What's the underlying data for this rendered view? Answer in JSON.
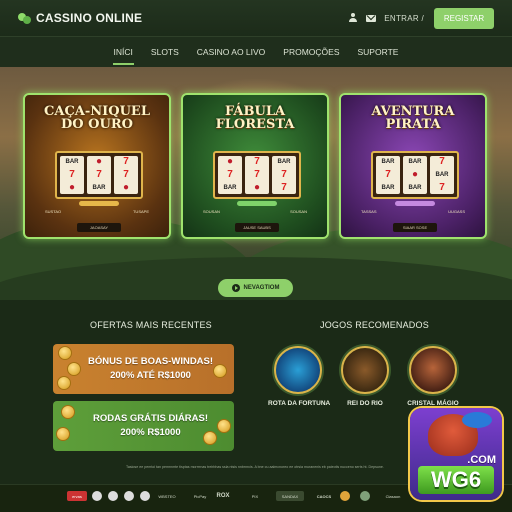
{
  "header": {
    "logo_text": "CASSINO ONLINE",
    "login_label": "ENTRAR /",
    "register_label": "REGISTAR"
  },
  "nav": {
    "items": [
      "INÍCI",
      "SLOTS",
      "CASINO AO LIVO",
      "PROMOÇÕES",
      "SUPORTE"
    ],
    "active_index": 0
  },
  "hero": {
    "cards": [
      {
        "title_line1": "CAÇA-NIQUEL",
        "title_line2": "DO OURO",
        "label_left": "SUSTAO",
        "label_right": "TUSAPE",
        "button": "JAOASAY"
      },
      {
        "title_line1": "FÁBULA",
        "title_line2": "FLORESTA",
        "label_left": "SOUSAN",
        "label_right": "SOUSAN",
        "button": "JAUSE SAUBS"
      },
      {
        "title_line1": "AVENTURA",
        "title_line2": "PIRATA",
        "label_left": "TASSAS",
        "label_right": "UUGASS",
        "button": "SIAAR SOSE"
      }
    ],
    "cta_label": "NEVAGTIOM"
  },
  "offers": {
    "title": "OFERTAS MAIS RECENTES",
    "items": [
      {
        "line1": "BÓNUS DE BOAS-WINDAS!",
        "line2": "200% ATÉ R$1000"
      },
      {
        "line1": "RODAS GRÁTIS DIÁRAS!",
        "line2": "200% R$1000"
      }
    ]
  },
  "recommended": {
    "title": "JOGOS RECOMENADOS",
    "games": [
      {
        "name": "ROTA DA FORTUNA",
        "icon": "wheel-icon"
      },
      {
        "name": "REI DO RIO",
        "icon": "river-icon"
      },
      {
        "name": "CRISTAL MÁGIO",
        "icon": "crystal-icon"
      }
    ]
  },
  "disclaimer": "Tasiose ee pemtoi tan pemrnmte tisptas morrrrnas treirbhas ssla ntsis nnbrnrcis. A bne cu aalmcnoreo ee otrsia muranenis eb paieotis nucceno serts ht. Depsune.",
  "footer": {
    "payments": [
      "ervas",
      "•",
      "•",
      "•",
      "•",
      "WBSTEO",
      "ROX",
      "PicPay",
      "PIX",
      "SANDAX",
      "CAOCS",
      "•",
      "•",
      "Clasaon"
    ]
  },
  "overlay": {
    "domain_badge": ".COM",
    "brand": "WG6"
  },
  "colors": {
    "accent_green": "#8ed06a",
    "background": "#1b2a17",
    "offer_orange": "#c9822f",
    "offer_green": "#5e9f3a"
  }
}
